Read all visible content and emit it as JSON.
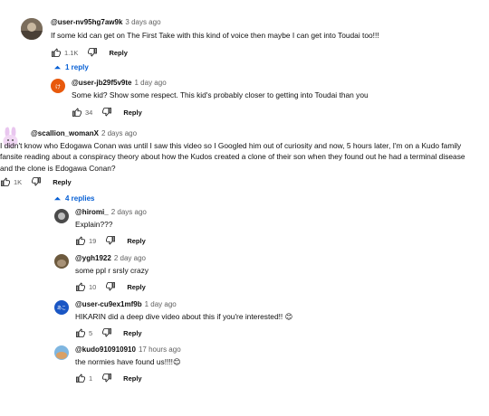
{
  "threads": [
    {
      "handle": "@user-nv95hg7aw9k",
      "time": "3 days ago",
      "text": "If some kid can get on The First Take with this kind of voice then maybe I can get into Toudai too!!!",
      "likes": "1.1K",
      "reply_label": "Reply",
      "toggle": "1 reply",
      "replies": [
        {
          "handle": "@user-jb29f5v9te",
          "time": "1 day ago",
          "text": "Some kid? Show some respect. This kid's probably closer to getting into Toudai than you",
          "likes": "34",
          "reply_label": "Reply",
          "avatar_letter": "け"
        }
      ]
    },
    {
      "handle": "@scallion_womanX",
      "time": "2 days ago",
      "text": "I didn't know who Edogawa Conan was until I saw this video so I Googled him out of curiosity and now, 5 hours later, I'm on a Kudo family fansite reading about a conspiracy theory about how the Kudos created a clone of their son when they found out he had a terminal disease and the clone is Edogawa Conan?",
      "likes": "1K",
      "reply_label": "Reply",
      "toggle": "4 replies",
      "replies": [
        {
          "handle": "@hiromi_",
          "time": "2 days ago",
          "text": "Explain???",
          "likes": "19",
          "reply_label": "Reply"
        },
        {
          "handle": "@ygh1922",
          "time": "2 day ago",
          "text": "some ppl r srsly crazy",
          "likes": "10",
          "reply_label": "Reply"
        },
        {
          "handle": "@user-cu9ex1mf9b",
          "time": "1 day ago",
          "text": "HIKARIN did a deep dive video about this if you're interested!! 😊",
          "likes": "5",
          "reply_label": "Reply",
          "avatar_letter": "あこ"
        },
        {
          "handle": "@kudo910910910",
          "time": "17 hours ago",
          "text": "the normies have found us!!!!😊",
          "likes": "1",
          "reply_label": "Reply"
        }
      ]
    }
  ],
  "colors": {
    "link_blue": "#065fd4",
    "muted": "#606060",
    "text": "#0f0f0f",
    "avatar_orange": "#e8590c",
    "avatar_blue": "#1a56c4"
  }
}
